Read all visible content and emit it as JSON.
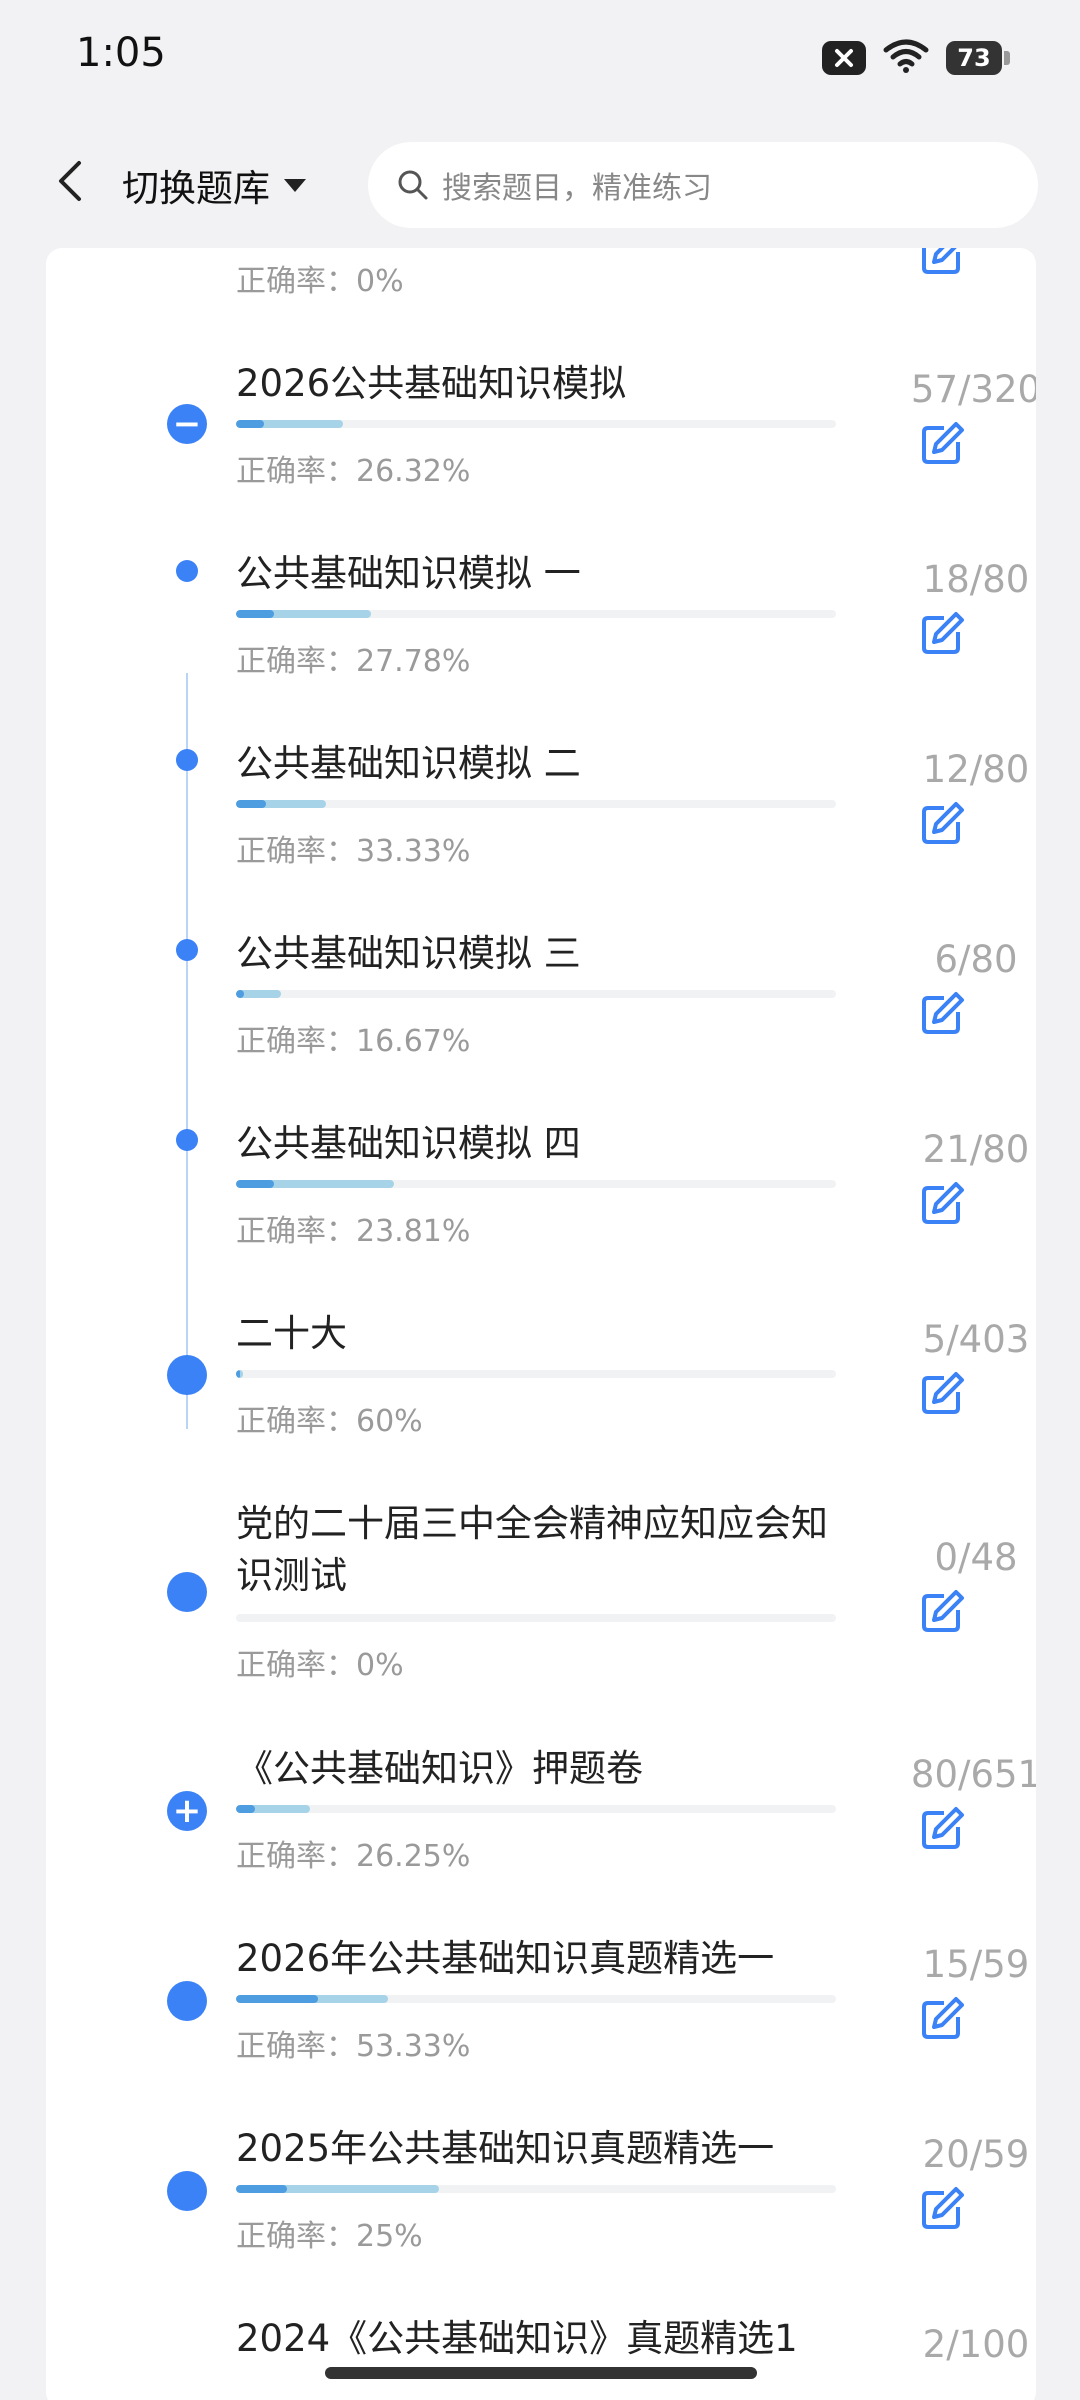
{
  "status_bar": {
    "time": "1:05",
    "battery": "73"
  },
  "header": {
    "switch_label": "切换题库",
    "search_placeholder": "搜索题目，精准练习"
  },
  "colors": {
    "accent": "#3b82f6",
    "bar_done": "#a7d3e8",
    "bar_correct": "#4d9de0",
    "muted": "#9a9a9a"
  },
  "accuracy_prefix": "正确率：",
  "items": [
    {
      "title": "",
      "accuracy": "正确率：0%",
      "count": "",
      "done_fraction": 0,
      "correct_fraction": 0,
      "marker": "small"
    },
    {
      "title": "2026公共基础知识模拟",
      "accuracy": "正确率：26.32%",
      "count": "57/320",
      "done_fraction": 0.178,
      "correct_fraction": 0.047,
      "marker": "minus"
    },
    {
      "title": "公共基础知识模拟 一",
      "accuracy": "正确率：27.78%",
      "count": "18/80",
      "done_fraction": 0.225,
      "correct_fraction": 0.0625,
      "marker": "small"
    },
    {
      "title": "公共基础知识模拟 二",
      "accuracy": "正确率：33.33%",
      "count": "12/80",
      "done_fraction": 0.15,
      "correct_fraction": 0.05,
      "marker": "small"
    },
    {
      "title": "公共基础知识模拟 三",
      "accuracy": "正确率：16.67%",
      "count": "6/80",
      "done_fraction": 0.075,
      "correct_fraction": 0.0125,
      "marker": "small"
    },
    {
      "title": "公共基础知识模拟 四",
      "accuracy": "正确率：23.81%",
      "count": "21/80",
      "done_fraction": 0.2625,
      "correct_fraction": 0.0625,
      "marker": "small"
    },
    {
      "title": "二十大",
      "accuracy": "正确率：60%",
      "count": "5/403",
      "done_fraction": 0.012,
      "correct_fraction": 0.007,
      "marker": "big"
    },
    {
      "title": "党的二十届三中全会精神应知应会知识测试",
      "accuracy": "正确率：0%",
      "count": "0/48",
      "done_fraction": 0,
      "correct_fraction": 0,
      "marker": "big"
    },
    {
      "title": "《公共基础知识》押题卷",
      "accuracy": "正确率：26.25%",
      "count": "80/651",
      "done_fraction": 0.123,
      "correct_fraction": 0.032,
      "marker": "plus"
    },
    {
      "title": "2026年公共基础知识真题精选一",
      "accuracy": "正确率：53.33%",
      "count": "15/59",
      "done_fraction": 0.254,
      "correct_fraction": 0.136,
      "marker": "big"
    },
    {
      "title": "2025年公共基础知识真题精选一",
      "accuracy": "正确率：25%",
      "count": "20/59",
      "done_fraction": 0.339,
      "correct_fraction": 0.085,
      "marker": "big"
    },
    {
      "title": "2024《公共基础知识》真题精选1",
      "accuracy": "",
      "count": "2/100",
      "done_fraction": 0,
      "correct_fraction": 0,
      "marker": "small"
    }
  ]
}
